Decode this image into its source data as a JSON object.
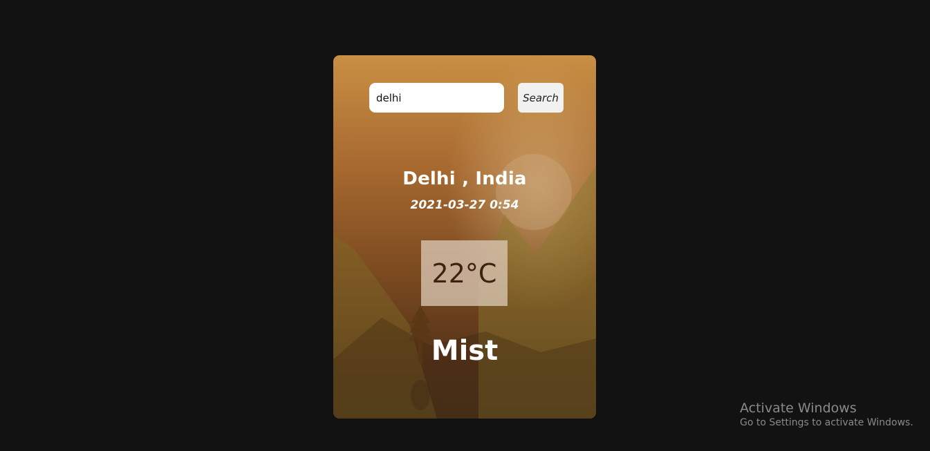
{
  "search": {
    "value": "delhi",
    "button_label": "Search"
  },
  "weather": {
    "location": "Delhi , India",
    "datetime": "2021-03-27 0:54",
    "temperature": "22°C",
    "condition": "Mist"
  },
  "watermark": {
    "title": "Activate Windows",
    "subtitle": "Go to Settings to activate Windows."
  },
  "colors": {
    "page_background": "#121212",
    "card_top": "#c98f44",
    "card_bottom": "#48311a",
    "text": "#ffffff",
    "temperature_text": "#3a2410",
    "watermark_text": "#8a8a8a"
  }
}
